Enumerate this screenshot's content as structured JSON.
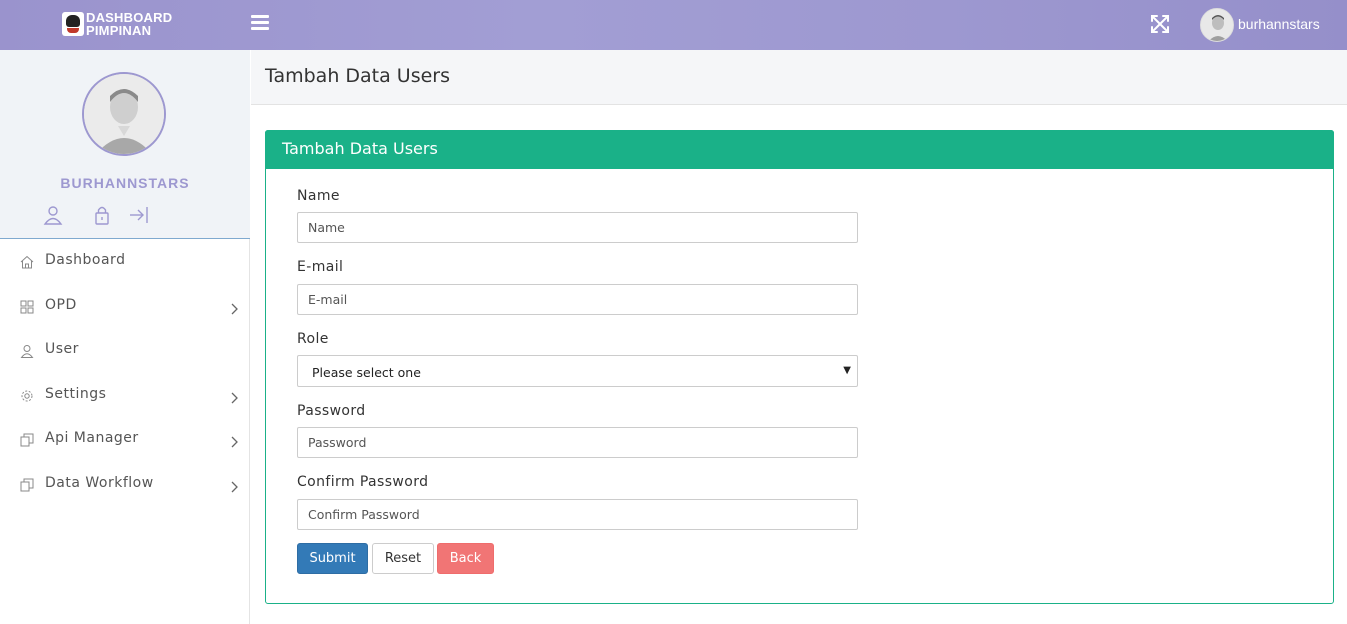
{
  "brand": {
    "line1": "DASHBOARD",
    "line2": "PIMPINAN"
  },
  "topbar": {
    "username": "burhannstars"
  },
  "profile": {
    "name": "BURHANNSTARS"
  },
  "sidebar": {
    "items": [
      {
        "label": "Dashboard",
        "icon": "home-icon",
        "has_children": false
      },
      {
        "label": "OPD",
        "icon": "grid-icon",
        "has_children": true
      },
      {
        "label": "User",
        "icon": "user-icon",
        "has_children": false
      },
      {
        "label": "Settings",
        "icon": "gear-icon",
        "has_children": true
      },
      {
        "label": "Api Manager",
        "icon": "documents-icon",
        "has_children": true
      },
      {
        "label": "Data Workflow",
        "icon": "documents-icon",
        "has_children": true
      }
    ]
  },
  "page": {
    "title": "Tambah Data Users"
  },
  "panel": {
    "title": "Tambah Data Users"
  },
  "form": {
    "name": {
      "label": "Name",
      "placeholder": "Name",
      "value": ""
    },
    "email": {
      "label": "E-mail",
      "placeholder": "E-mail",
      "value": ""
    },
    "role": {
      "label": "Role",
      "selected": "Please select one"
    },
    "password": {
      "label": "Password",
      "placeholder": "Password",
      "value": ""
    },
    "confirm_password": {
      "label": "Confirm Password",
      "placeholder": "Confirm Password",
      "value": ""
    },
    "buttons": {
      "submit": "Submit",
      "reset": "Reset",
      "back": "Back"
    }
  },
  "colors": {
    "topbar": "#9d98d0",
    "panel_header": "#1ab188",
    "submit": "#337ab7",
    "back": "#f17575",
    "profile_name": "#9d98d0"
  }
}
